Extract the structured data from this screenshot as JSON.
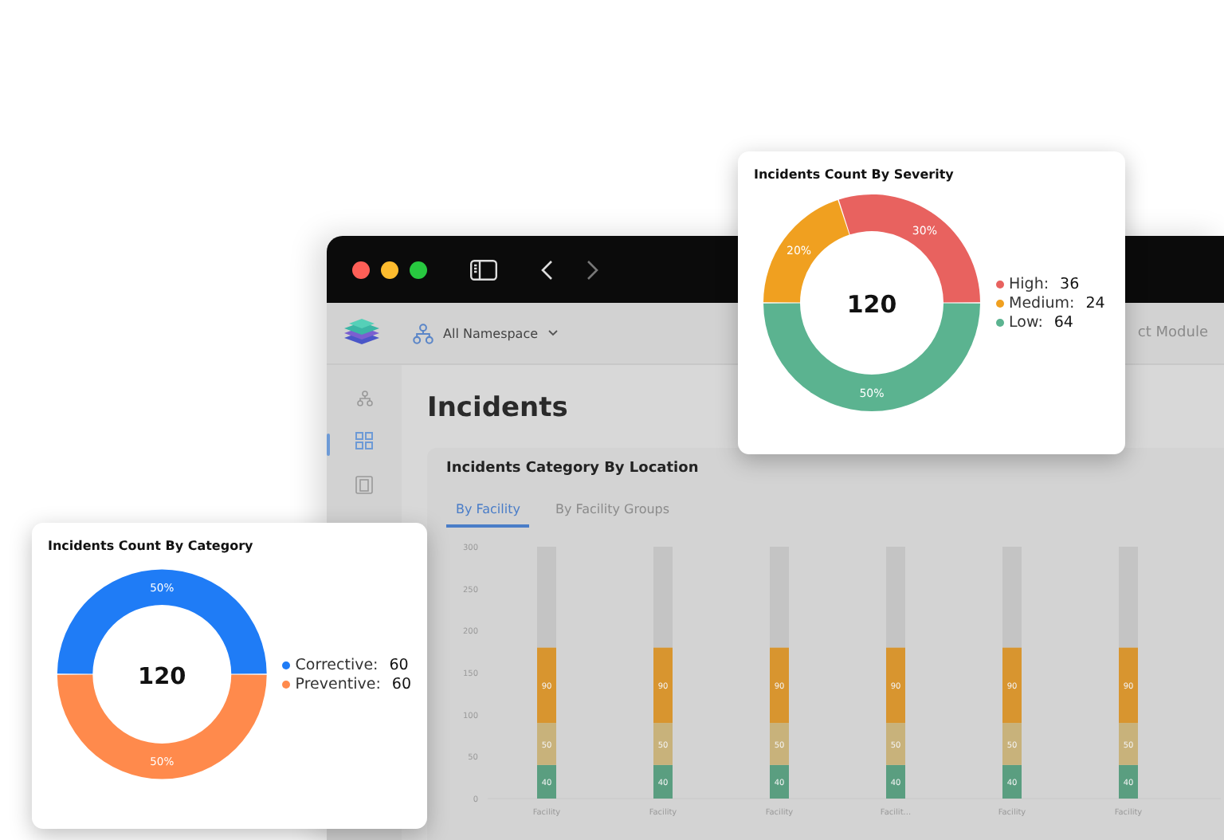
{
  "severity_card": {
    "title": "Incidents Count By Severity",
    "total": "120",
    "legend": [
      {
        "label": "High:",
        "value": "36",
        "color": "#e8625f"
      },
      {
        "label": "Medium:",
        "value": "24",
        "color": "#f0a020"
      },
      {
        "label": "Low:",
        "value": "64",
        "color": "#5bb390"
      }
    ],
    "chart_data": {
      "type": "donut",
      "values": [
        30,
        20,
        50
      ],
      "value_labels": [
        "30%",
        "20%",
        "50%"
      ]
    }
  },
  "app_window": {
    "namespace": "All Namespace",
    "top_right_text": "ct Module",
    "sidebar": {
      "items": [
        {
          "selected": false
        },
        {
          "selected": true
        },
        {
          "selected": false
        }
      ]
    },
    "page_title": "Incidents",
    "location_card": {
      "title": "Incidents Category By Location",
      "tabs": [
        {
          "label": "By Facility",
          "selected": true
        },
        {
          "label": "By Facility Groups",
          "selected": false
        }
      ],
      "chart_data": {
        "type": "bar",
        "stacked": true,
        "categories": [
          "Facility",
          "Facility",
          "Facility",
          "Facilit...",
          "Facility",
          "Facility"
        ],
        "ylim": [
          0,
          300
        ],
        "yticks": [
          0,
          50,
          100,
          150,
          200,
          250,
          300
        ],
        "data_labels": true,
        "series": [
          {
            "color": "#5a9e80",
            "values": [
              40,
              40,
              40,
              40,
              40,
              40
            ]
          },
          {
            "color": "#c8b27b",
            "values": [
              50,
              50,
              50,
              50,
              50,
              50
            ]
          },
          {
            "color": "#d8952f",
            "values": [
              90,
              90,
              90,
              90,
              90,
              90
            ]
          },
          {
            "color": "#c4c4c4",
            "values": [
              120,
              120,
              120,
              120,
              120,
              120
            ],
            "data_labels": false
          }
        ]
      }
    }
  },
  "category_card": {
    "title": "Incidents Count By Category",
    "total": "120",
    "legend": [
      {
        "label": "Corrective:",
        "value": "60",
        "color": "#1f7cf6"
      },
      {
        "label": "Preventive:",
        "value": "60",
        "color": "#ff8a4c"
      }
    ],
    "chart_data": {
      "type": "donut",
      "values": [
        50,
        50
      ],
      "value_labels": [
        "50%",
        "50%"
      ]
    }
  }
}
